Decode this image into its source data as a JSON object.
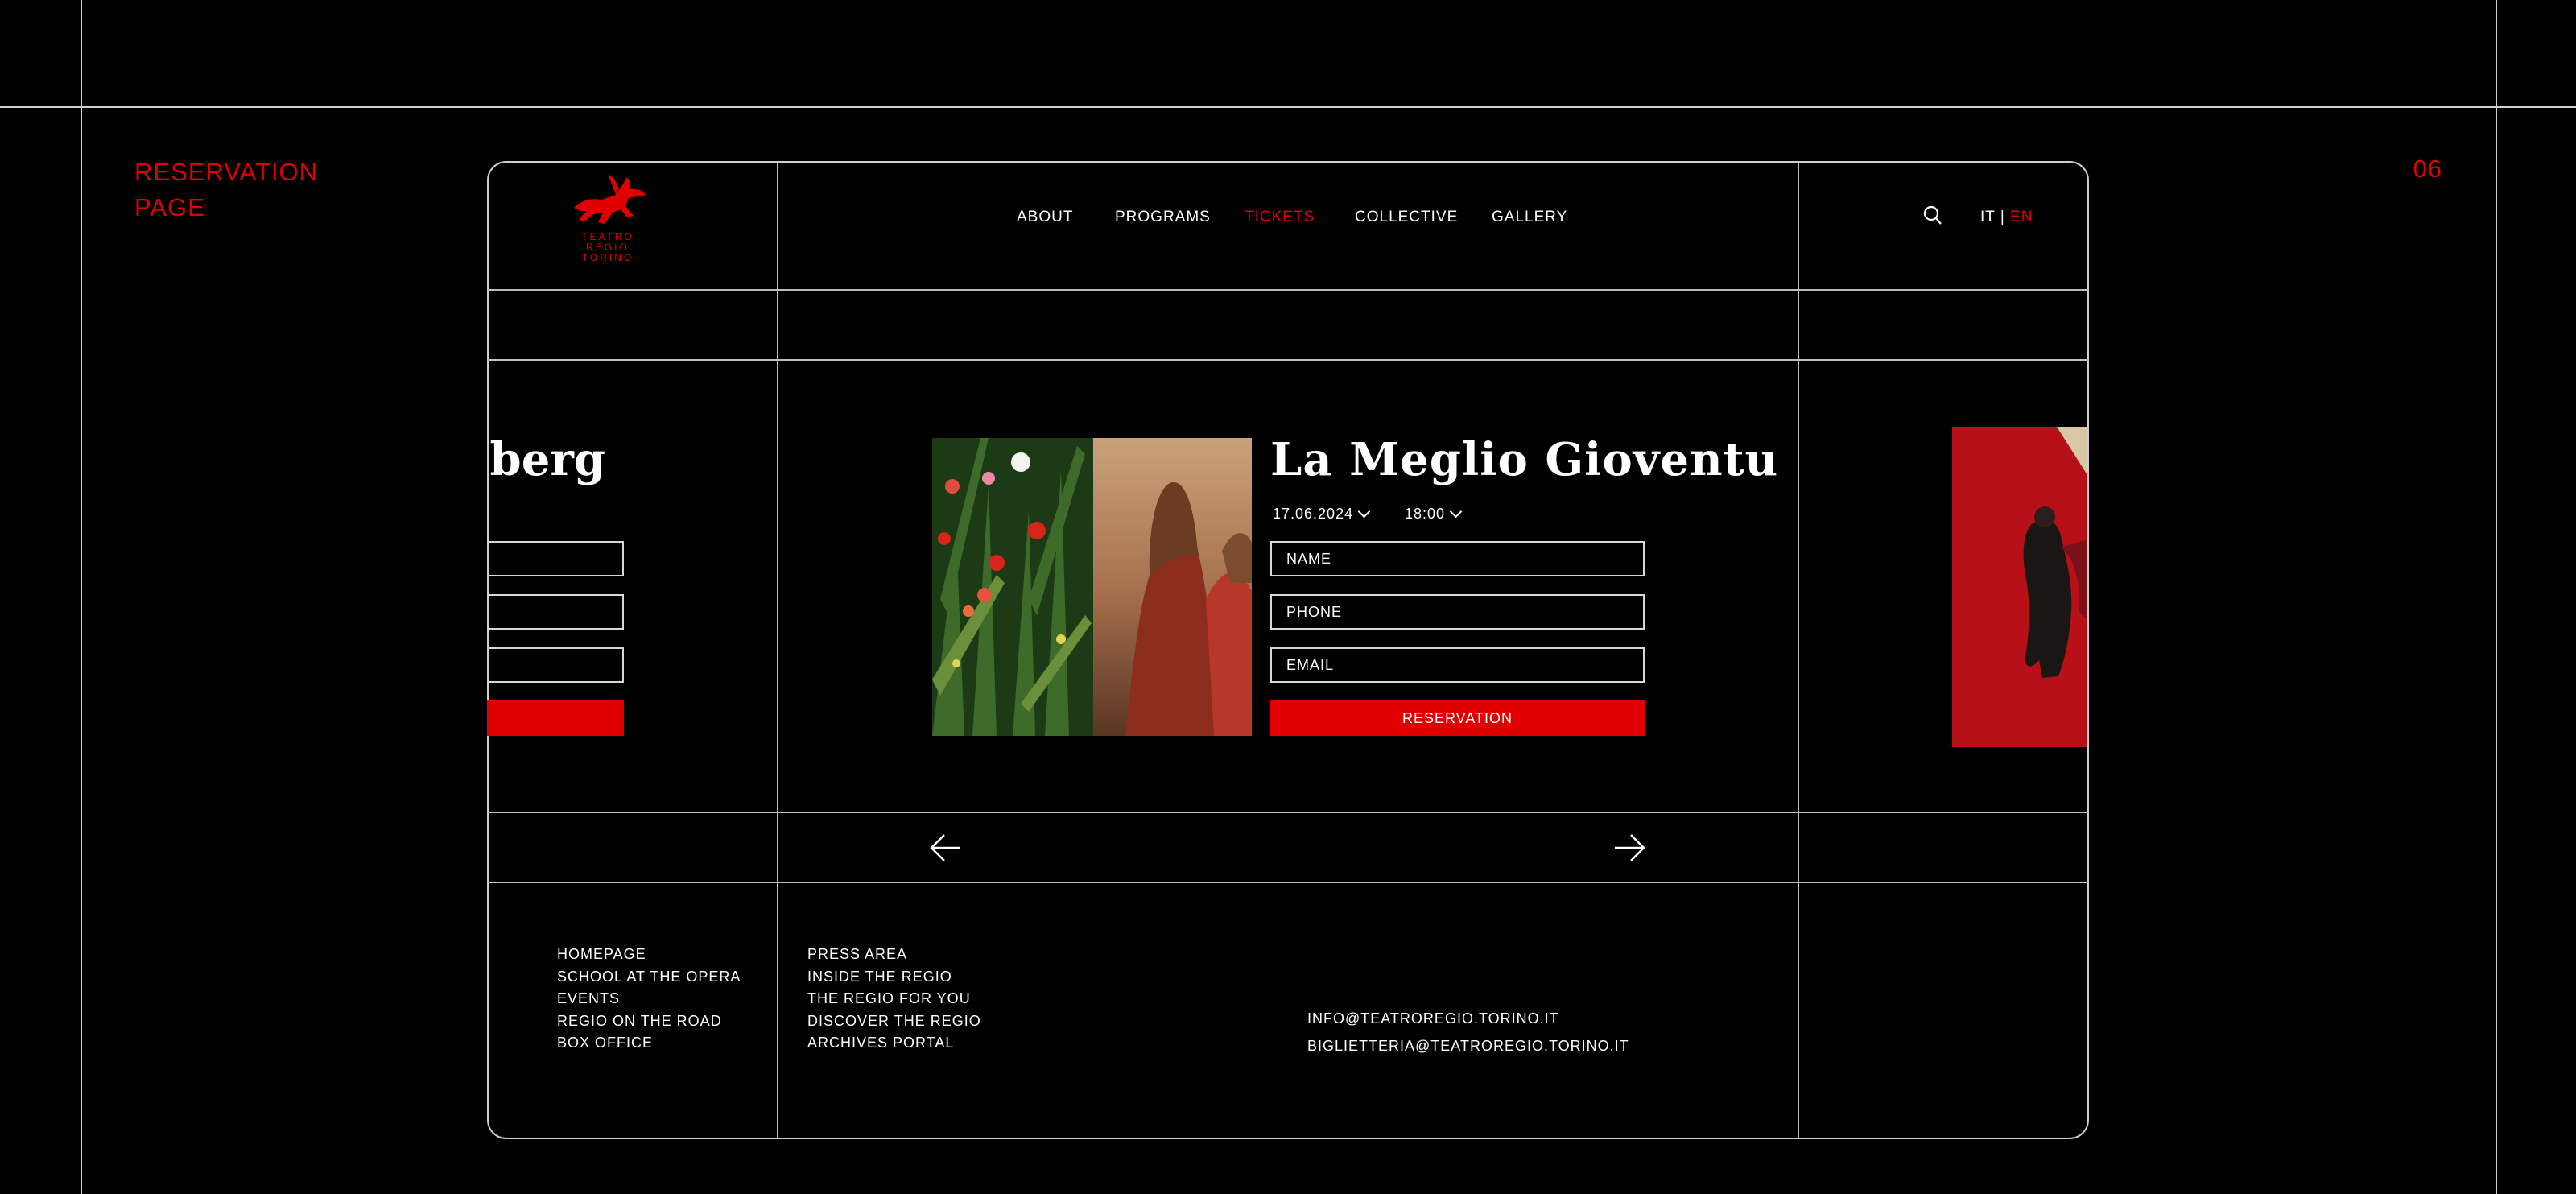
{
  "side": {
    "title_line1": "RESERVATION",
    "title_line2": "PAGE",
    "page_number": "06"
  },
  "header": {
    "logo_text": [
      "TEATRO",
      "REGIO",
      "TORINO"
    ],
    "nav": [
      {
        "label": "ABOUT",
        "active": false
      },
      {
        "label": "PROGRAMS",
        "active": false
      },
      {
        "label": "TICKETS",
        "active": true
      },
      {
        "label": "COLLECTIVE",
        "active": false
      },
      {
        "label": "GALLERY",
        "active": false
      }
    ],
    "lang": {
      "it": "IT",
      "separator": "|",
      "en": "EN"
    }
  },
  "prev_event": {
    "title_fragment": "nberg"
  },
  "event": {
    "title": "La Meglio Gioventu",
    "date": "17.06.2024",
    "time": "18:00",
    "name_placeholder": "NAME",
    "phone_placeholder": "PHONE",
    "email_placeholder": "EMAIL",
    "reservation_button": "RESERVATION"
  },
  "footer": {
    "col1": [
      "HOMEPAGE",
      "SCHOOL AT THE OPERA",
      "EVENTS",
      "REGIO ON THE ROAD",
      "BOX OFFICE"
    ],
    "col2": [
      "PRESS AREA",
      "INSIDE THE REGIO",
      "THE REGIO FOR YOU",
      "DISCOVER THE REGIO",
      "ARCHIVES PORTAL"
    ],
    "contacts": [
      "INFO@TEATROREGIO.TORINO.IT",
      "BIGLIETTERIA@TEATROREGIO.TORINO.IT"
    ]
  },
  "colors": {
    "accent": "#e00000",
    "background": "#000000",
    "lines": "#cfcfcf"
  },
  "icons": [
    "search-icon",
    "arrow-left-icon",
    "arrow-right-icon",
    "chevron-down-icon",
    "logo-horse-icon"
  ]
}
